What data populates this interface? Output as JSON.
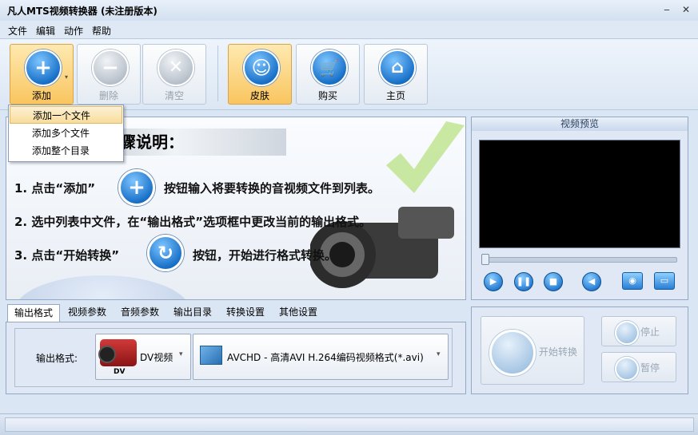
{
  "window": {
    "title": "凡人MTS视频转换器  (未注册版本)",
    "minimize_glyph": "‒",
    "close_glyph": "✕"
  },
  "menu": [
    "文件",
    "编辑",
    "动作",
    "帮助"
  ],
  "toolbar": {
    "add": "添加",
    "delete": "删除",
    "clear": "清空",
    "skin": "皮肤",
    "buy": "购买",
    "home": "主页"
  },
  "add_dropdown": [
    "添加一个文件",
    "添加多个文件",
    "添加整个目录"
  ],
  "instructions": {
    "heading": "骤说明：",
    "step1_a": "1. 点击“添加”",
    "step1_b": "按钮输入将要转换的音视频文件到列表。",
    "step2": "2. 选中列表中文件，在“输出格式”选项框中更改当前的输出格式。",
    "step3_a": "3. 点击“开始转换”",
    "step3_b": "按钮，开始进行格式转换。"
  },
  "preview": {
    "title": "视频预览"
  },
  "tabs": [
    "输出格式",
    "视频参数",
    "音频参数",
    "输出目录",
    "转换设置",
    "其他设置"
  ],
  "output": {
    "label": "输出格式:",
    "category": "DV视频",
    "category_icon_text": "DV",
    "format": "AVCHD - 高清AVI H.264编码视频格式(*.avi)"
  },
  "actions": {
    "start": "开始转换",
    "stop": "停止",
    "pause": "暂停"
  },
  "colors": {
    "accent_blue": "#1a72c9",
    "active_orange": "#f9c55f"
  }
}
